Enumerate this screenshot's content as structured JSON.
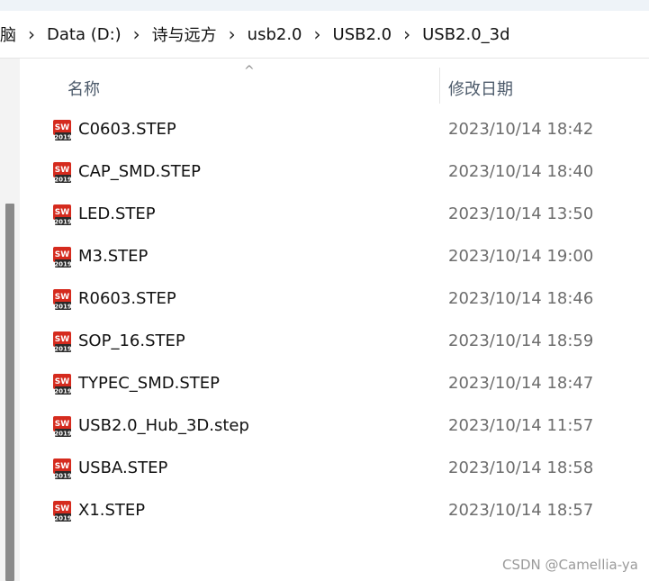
{
  "breadcrumb": [
    {
      "label": "脑"
    },
    {
      "label": "Data (D:)"
    },
    {
      "label": "诗与远方"
    },
    {
      "label": "usb2.0"
    },
    {
      "label": "USB2.0"
    },
    {
      "label": "USB2.0_3d"
    }
  ],
  "breadcrumb_separator": "›",
  "columns": {
    "name": "名称",
    "date": "修改日期",
    "sort_indicator": "^"
  },
  "file_icon": {
    "name": "solidworks-2019-icon",
    "text_top": "SW",
    "text_year": "2019",
    "color": "#d52b1e"
  },
  "files": [
    {
      "name": "C0603.STEP",
      "modified": "2023/10/14 18:42"
    },
    {
      "name": "CAP_SMD.STEP",
      "modified": "2023/10/14 18:40"
    },
    {
      "name": "LED.STEP",
      "modified": "2023/10/14 13:50"
    },
    {
      "name": "M3.STEP",
      "modified": "2023/10/14 19:00"
    },
    {
      "name": "R0603.STEP",
      "modified": "2023/10/14 18:46"
    },
    {
      "name": "SOP_16.STEP",
      "modified": "2023/10/14 18:59"
    },
    {
      "name": "TYPEC_SMD.STEP",
      "modified": "2023/10/14 18:47"
    },
    {
      "name": "USB2.0_Hub_3D.step",
      "modified": "2023/10/14 11:57"
    },
    {
      "name": "USBA.STEP",
      "modified": "2023/10/14 18:58"
    },
    {
      "name": "X1.STEP",
      "modified": "2023/10/14 18:57"
    }
  ],
  "watermark": "CSDN @Camellia-ya"
}
